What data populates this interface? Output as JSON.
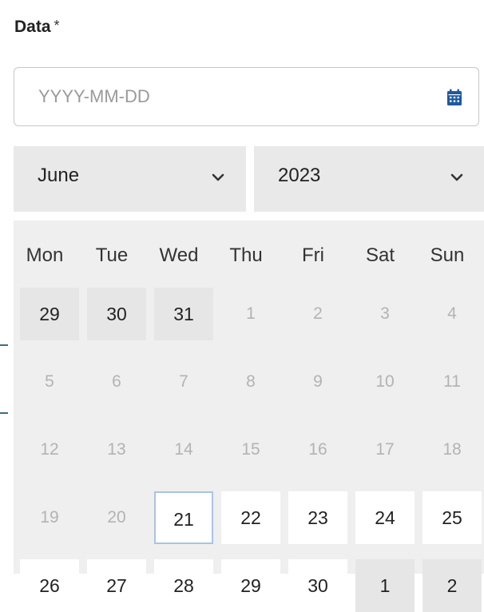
{
  "field": {
    "label": "Data",
    "required_marker": "*",
    "value": "",
    "placeholder": "YYYY-MM-DD",
    "calendar_icon": "calendar-icon",
    "accent_color": "#1e5a9e"
  },
  "picker": {
    "month": "June",
    "year": "2023",
    "chevron_icon": "chevron-down-icon",
    "weekdays": [
      "Mon",
      "Tue",
      "Wed",
      "Thu",
      "Fri",
      "Sat",
      "Sun"
    ],
    "weeks": [
      [
        {
          "d": "29",
          "s": "outside"
        },
        {
          "d": "30",
          "s": "outside"
        },
        {
          "d": "31",
          "s": "outside"
        },
        {
          "d": "1",
          "s": "disabled"
        },
        {
          "d": "2",
          "s": "disabled"
        },
        {
          "d": "3",
          "s": "disabled"
        },
        {
          "d": "4",
          "s": "disabled"
        }
      ],
      [
        {
          "d": "5",
          "s": "disabled"
        },
        {
          "d": "6",
          "s": "disabled"
        },
        {
          "d": "7",
          "s": "disabled"
        },
        {
          "d": "8",
          "s": "disabled"
        },
        {
          "d": "9",
          "s": "disabled"
        },
        {
          "d": "10",
          "s": "disabled"
        },
        {
          "d": "11",
          "s": "disabled"
        }
      ],
      [
        {
          "d": "12",
          "s": "disabled"
        },
        {
          "d": "13",
          "s": "disabled"
        },
        {
          "d": "14",
          "s": "disabled"
        },
        {
          "d": "15",
          "s": "disabled"
        },
        {
          "d": "16",
          "s": "disabled"
        },
        {
          "d": "17",
          "s": "disabled"
        },
        {
          "d": "18",
          "s": "disabled"
        }
      ],
      [
        {
          "d": "19",
          "s": "disabled"
        },
        {
          "d": "20",
          "s": "disabled"
        },
        {
          "d": "21",
          "s": "today"
        },
        {
          "d": "22",
          "s": "enabled"
        },
        {
          "d": "23",
          "s": "enabled"
        },
        {
          "d": "24",
          "s": "enabled"
        },
        {
          "d": "25",
          "s": "enabled"
        }
      ],
      [
        {
          "d": "26",
          "s": "enabled"
        },
        {
          "d": "27",
          "s": "enabled"
        },
        {
          "d": "28",
          "s": "enabled"
        },
        {
          "d": "29",
          "s": "enabled"
        },
        {
          "d": "30",
          "s": "enabled"
        },
        {
          "d": "1",
          "s": "next-month"
        },
        {
          "d": "2",
          "s": "next-month"
        }
      ]
    ]
  }
}
